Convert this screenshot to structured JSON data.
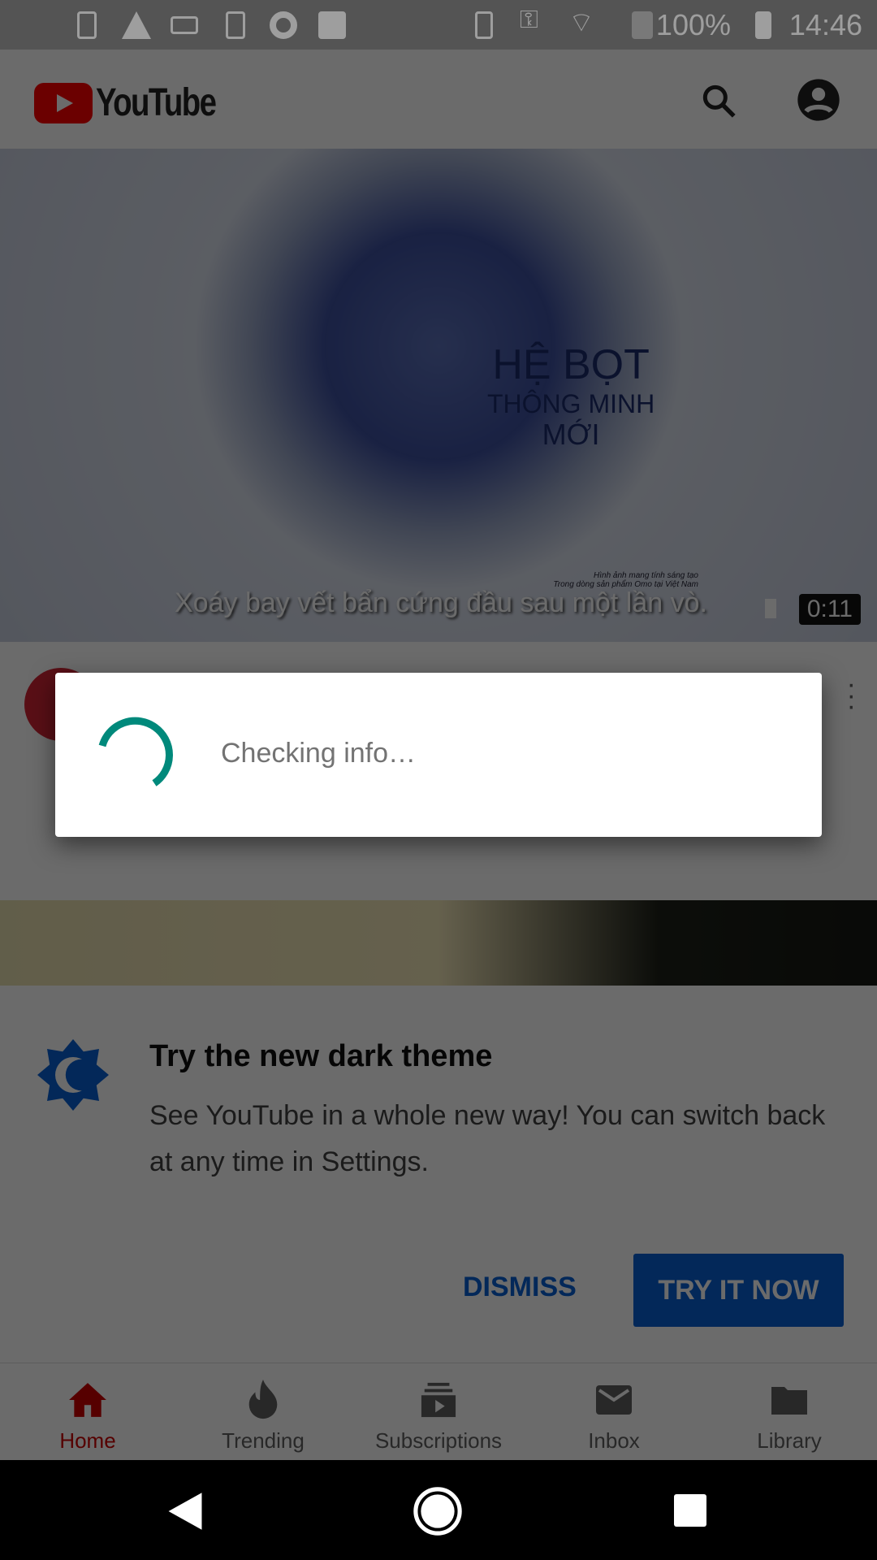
{
  "status_bar": {
    "battery": "100%",
    "time": "14:46"
  },
  "header": {
    "logo": "YouTube"
  },
  "video": {
    "title_lines": [
      "HỆ BỌT",
      "THÔNG MINH",
      "MỚI"
    ],
    "fine_print": [
      "Hình ảnh mang tính sáng tạo",
      "Trong dòng sản phẩm Omo tại Việt Nam"
    ],
    "subtitle": "Xoáy bay vết bẩn cứng đầu sau một lần vò.",
    "duration": "0:11"
  },
  "dialog": {
    "message": "Checking info…"
  },
  "promo": {
    "title": "Try the new dark theme",
    "body": "See YouTube in a whole new way! You can switch back at any time in Settings.",
    "dismiss": "DISMISS",
    "try": "TRY IT NOW"
  },
  "nav": {
    "items": [
      {
        "label": "Home"
      },
      {
        "label": "Trending"
      },
      {
        "label": "Subscriptions"
      },
      {
        "label": "Inbox"
      },
      {
        "label": "Library"
      }
    ]
  },
  "colors": {
    "accent": "#065fd4",
    "brand": "#ff0000",
    "spinner": "#00897b"
  }
}
